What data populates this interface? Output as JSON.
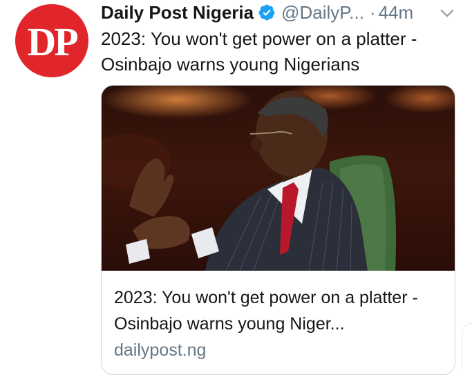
{
  "tweet": {
    "avatar_text": "DP",
    "display_name": "Daily Post Nigeria",
    "handle": "@DailyP...",
    "separator": "·",
    "time": "44m",
    "text": "2023: You won't get power on a platter - Osinbajo warns young Nigerians"
  },
  "card": {
    "title": "2023: You won't get power on a platter - Osinbajo warns young Niger...",
    "domain": "dailypost.ng"
  },
  "colors": {
    "brand_red": "#e0262a",
    "verified_blue": "#1da1f2",
    "secondary_text": "#657786"
  },
  "icons": {
    "verified": "verified-badge-icon",
    "more": "chevron-down-icon"
  }
}
